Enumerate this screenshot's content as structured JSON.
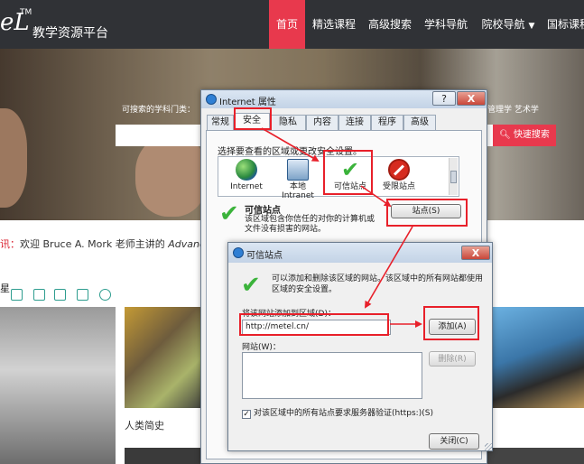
{
  "site": {
    "logo_text": "eL",
    "logo_tm": "TM",
    "logo_subtitle": "教学资源平台",
    "nav": [
      {
        "label": "首页"
      },
      {
        "label": "精选课程"
      },
      {
        "label": "高级搜索"
      },
      {
        "label": "学科导航"
      },
      {
        "label": "院校导航"
      },
      {
        "label": "国标课程"
      }
    ],
    "hero_label": "可搜索的学科门类：",
    "hero_subjects": "管理学  艺术学",
    "search_button": "快速搜索",
    "announce_prefix": "讯：",
    "announce_text": "欢迎 Bruce A. Mork 老师主讲的 ",
    "announce_course": "Advanced",
    "section_char": "星",
    "thumb_caption": "人类简史"
  },
  "internet_options": {
    "title": "Internet 属性",
    "help": "?",
    "close": "X",
    "tabs": [
      "常规",
      "安全",
      "隐私",
      "内容",
      "连接",
      "程序",
      "高级"
    ],
    "active_tab": "安全",
    "zone_prompt": "选择要查看的区域或更改安全设置。",
    "zones": [
      {
        "label": "Internet",
        "icon": "globe-icon"
      },
      {
        "label": "本地 Intranet",
        "icon": "computer-icon"
      },
      {
        "label": "可信站点",
        "icon": "checkmark-icon"
      },
      {
        "label": "受限站点",
        "icon": "no-entry-icon"
      }
    ],
    "trusted_title": "可信站点",
    "trusted_desc": "该区域包含你信任的对你的计算机或文件没有损害的网站。",
    "sites_button": "站点(S)"
  },
  "trusted_sites": {
    "title": "可信站点",
    "close": "X",
    "intro": "可以添加和删除该区域的网站。该区域中的所有网站都使用区域的安全设置。",
    "add_label": "将该网站添加到区域(D)：",
    "url_value": "http://metel.cn/",
    "add_button": "添加(A)",
    "sites_label": "网站(W)：",
    "remove_button": "删除(R)",
    "https_label": "对该区域中的所有站点要求服务器验证(https:)(S)",
    "https_checked": "✓",
    "close_button": "关闭(C)"
  },
  "colors": {
    "accent_red": "#e8394d",
    "annotation_red": "#e8202a",
    "check_green": "#3bb33b",
    "header_dark": "#303236"
  }
}
